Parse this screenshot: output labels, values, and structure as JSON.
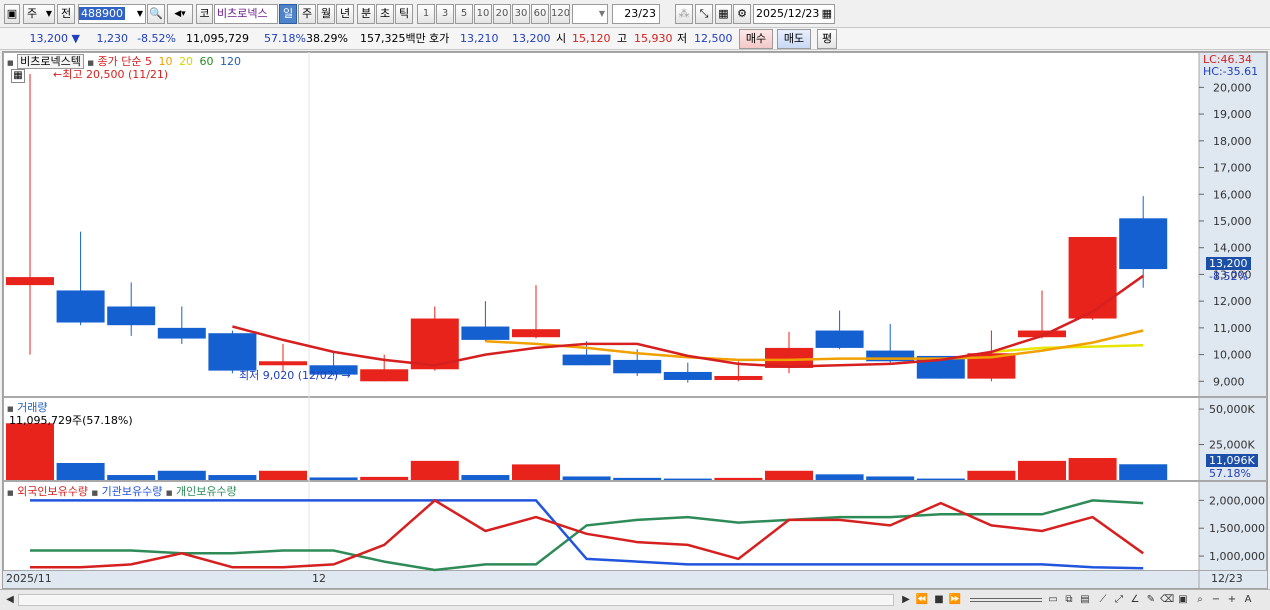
{
  "toolbar": {
    "menu_glyph": "▣",
    "period_select": "주",
    "prev_label": "전",
    "code": "488900",
    "exchange_label": "코",
    "name": "비츠로넥스",
    "tabs": [
      "일",
      "주",
      "월",
      "년",
      "분",
      "초",
      "틱"
    ],
    "active_tab": "일",
    "intervals": [
      "1",
      "3",
      "5",
      "10",
      "20",
      "30",
      "60",
      "120"
    ],
    "count": "23/23",
    "date": "2025/12/23"
  },
  "quote": {
    "price": "13,200",
    "change": "1,230",
    "change_pct": "-8.52%",
    "volume": "11,095,729",
    "vol_ratio": "57.18%",
    "turnover": "38.29%",
    "amount": "157,325백만",
    "hoga_label": "호가",
    "ask": "13,210",
    "bid": "13,200",
    "open_label": "시",
    "open": "15,120",
    "high_label": "고",
    "high": "15,930",
    "low_label": "저",
    "low": "12,500",
    "buy_button": "매수",
    "sell_button": "매도",
    "eval_button": "평"
  },
  "price_pane": {
    "stock_label": "비츠로넥스텍",
    "ma_label": "종가 단순",
    "ma_periods": [
      "5",
      "10",
      "20",
      "60",
      "120"
    ],
    "ma_colors": [
      "#d62020",
      "#f0a000",
      "#e6e600",
      "#228b22",
      "#1f5fbf"
    ],
    "high_annot": "←최고 20,500 (11/21)",
    "low_annot": "최저 9,020 (12/02) →",
    "lc": "LC:46.34",
    "hc": "HC:-35.61",
    "y_ticks": [
      "20,000",
      "19,000",
      "18,000",
      "17,000",
      "16,000",
      "15,000",
      "14,000",
      "13,000",
      "12,000",
      "11,000",
      "10,000",
      "9,000"
    ],
    "price_tag": "13,200",
    "pct_tag": "-8.52%"
  },
  "volume_pane": {
    "title": "거래량",
    "value_label": "11,095,729주(57.18%)",
    "y_ticks": [
      "50,000K",
      "25,000K"
    ],
    "vol_tag": "11,096K",
    "pct_tag": "57.18%"
  },
  "holdings_pane": {
    "labels": [
      "외국인보유수량",
      "기관보유수량",
      "개인보유수량"
    ],
    "colors": [
      "#d62020",
      "#2255dd",
      "#2e8b57"
    ],
    "y_ticks": [
      "2,000,000",
      "1,500,000",
      "1,000,000"
    ]
  },
  "x_axis": {
    "labels": [
      "2025/11",
      "12"
    ],
    "end_label": "12/23"
  },
  "chart_data": [
    {
      "type": "candlestick",
      "title": "비츠로넥스텍",
      "ylim": [
        8600,
        20500
      ],
      "candles": [
        {
          "o": 12600,
          "h": 20500,
          "l": 10000,
          "c": 12900
        },
        {
          "o": 12400,
          "h": 14600,
          "l": 11100,
          "c": 11200
        },
        {
          "o": 11800,
          "h": 12700,
          "l": 10700,
          "c": 11100
        },
        {
          "o": 11000,
          "h": 11800,
          "l": 10400,
          "c": 10600
        },
        {
          "o": 10800,
          "h": 10900,
          "l": 9300,
          "c": 9400
        },
        {
          "o": 9600,
          "h": 10400,
          "l": 9350,
          "c": 9750
        },
        {
          "o": 9600,
          "h": 10100,
          "l": 9200,
          "c": 9250
        },
        {
          "o": 9000,
          "h": 10000,
          "l": 9000,
          "c": 9450
        },
        {
          "o": 9450,
          "h": 11800,
          "l": 9400,
          "c": 11350
        },
        {
          "o": 11050,
          "h": 12000,
          "l": 10500,
          "c": 10550
        },
        {
          "o": 10650,
          "h": 12600,
          "l": 10600,
          "c": 10950
        },
        {
          "o": 10000,
          "h": 10500,
          "l": 9600,
          "c": 9600
        },
        {
          "o": 9800,
          "h": 10200,
          "l": 9200,
          "c": 9300
        },
        {
          "o": 9350,
          "h": 9700,
          "l": 8950,
          "c": 9050
        },
        {
          "o": 9050,
          "h": 9750,
          "l": 9000,
          "c": 9200
        },
        {
          "o": 9500,
          "h": 10850,
          "l": 9300,
          "c": 10250
        },
        {
          "o": 10900,
          "h": 11650,
          "l": 10200,
          "c": 10250
        },
        {
          "o": 10150,
          "h": 11150,
          "l": 9700,
          "c": 9750
        },
        {
          "o": 9950,
          "h": 9950,
          "l": 9100,
          "c": 9100
        },
        {
          "o": 9100,
          "h": 10900,
          "l": 9000,
          "c": 10050
        },
        {
          "o": 10650,
          "h": 12400,
          "l": 10600,
          "c": 10900
        },
        {
          "o": 11350,
          "h": 14400,
          "l": 11300,
          "c": 14400
        },
        {
          "o": 15100,
          "h": 15930,
          "l": 12500,
          "c": 13200
        }
      ],
      "ma5": [
        null,
        null,
        null,
        null,
        11050,
        10550,
        10100,
        9800,
        9600,
        10000,
        10250,
        10400,
        10400,
        9950,
        9650,
        9550,
        9600,
        9650,
        9800,
        10100,
        10700,
        11600,
        12950
      ],
      "ma10": [
        null,
        null,
        null,
        null,
        null,
        null,
        null,
        null,
        null,
        10500,
        10400,
        10250,
        10050,
        9900,
        9800,
        9800,
        9850,
        9850,
        9850,
        9900,
        10150,
        10450,
        10900
      ],
      "ma20": [
        null,
        null,
        null,
        null,
        null,
        null,
        null,
        null,
        null,
        null,
        null,
        null,
        null,
        null,
        null,
        null,
        null,
        null,
        null,
        10100,
        10250,
        10300,
        10350
      ]
    },
    {
      "type": "bar",
      "title": "거래량",
      "ylim": [
        0,
        55000
      ],
      "values": [
        40000,
        12000,
        3500,
        6500,
        3500,
        6500,
        1800,
        2200,
        13500,
        3500,
        11000,
        2500,
        1500,
        1000,
        1500,
        6500,
        4000,
        2500,
        1000,
        6500,
        13500,
        15500,
        11096
      ],
      "up": [
        true,
        false,
        false,
        false,
        false,
        true,
        false,
        true,
        true,
        false,
        true,
        false,
        false,
        false,
        true,
        true,
        false,
        false,
        false,
        true,
        true,
        true,
        false
      ]
    },
    {
      "type": "line",
      "ylim": [
        750000,
        2150000
      ],
      "series": [
        {
          "name": "외국인보유수량",
          "values": [
            800000,
            800000,
            850000,
            1050000,
            800000,
            800000,
            850000,
            1200000,
            2000000,
            1450000,
            1700000,
            1400000,
            1250000,
            1200000,
            950000,
            1650000,
            1650000,
            1550000,
            1950000,
            1550000,
            1450000,
            1700000,
            1050000
          ]
        },
        {
          "name": "기관보유수량",
          "values": [
            2000000,
            2000000,
            2000000,
            2000000,
            2000000,
            2000000,
            2000000,
            2000000,
            2000000,
            2000000,
            2000000,
            950000,
            900000,
            850000,
            850000,
            850000,
            850000,
            850000,
            850000,
            850000,
            850000,
            800000,
            780000
          ]
        },
        {
          "name": "개인보유수량",
          "values": [
            1100000,
            1100000,
            1100000,
            1050000,
            1050000,
            1100000,
            1100000,
            900000,
            750000,
            850000,
            850000,
            1550000,
            1650000,
            1700000,
            1600000,
            1650000,
            1700000,
            1700000,
            1750000,
            1750000,
            1750000,
            2000000,
            1950000
          ]
        }
      ]
    }
  ]
}
